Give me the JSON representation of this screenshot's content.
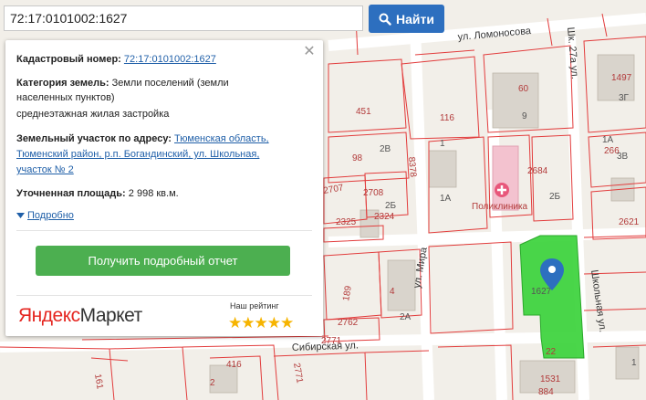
{
  "search": {
    "value": "72:17:0101002:1627",
    "button_label": "Найти"
  },
  "popup": {
    "cadastral_label": "Кадастровый номер:",
    "cadastral_value": "72:17:0101002:1627",
    "category_label": "Категория земель:",
    "category_value_line1": "Земли поселений (земли",
    "category_value_line2": "населенных пунктов)",
    "category_value_line3": "среднеэтажная жилая застройка",
    "address_label": "Земельный участок по адресу:",
    "address_line1": "Тюменская область,",
    "address_line2": "Тюменский район, р.п. Богандинский, ул. Школьная,",
    "address_line3": "участок № 2",
    "area_label": "Уточненная площадь:",
    "area_value": "2 998 кв.м.",
    "details_link": "Подробно",
    "report_button": "Получить подробный отчет",
    "brand_yandex": "Яндекс",
    "brand_market": "Маркет",
    "rating_label": "Наш рейтинг",
    "rating_stars": "★★★★★"
  },
  "map": {
    "streets": {
      "lomonosova": "ул. Ломоносова",
      "mira": "ул. Мира",
      "shkolnaya": "Школьная ул.",
      "sibirskaya": "Сибирская ул.",
      "shkolnaya_top": "Шк. 27а ул."
    },
    "poi": {
      "polyclinic": "Поликлиника"
    },
    "selected_parcel_label": "1627",
    "parcel_labels": [
      "451",
      "116",
      "60",
      "9",
      "1497",
      "3Г",
      "1А",
      "266",
      "3В",
      "2684",
      "2Б",
      "2В",
      "98",
      "1",
      "8378",
      "2707",
      "2708",
      "2Б",
      "2324",
      "2325",
      "1А",
      "2621",
      "189",
      "4",
      "2А",
      "2762",
      "2771",
      "416",
      "2771",
      "2",
      "161",
      "884",
      "1531",
      "22",
      "1"
    ],
    "colors": {
      "parcel_line": "#e23c3c",
      "selected_fill": "#3bd23b",
      "marker": "#2d6fbf",
      "building": "#d9d4cc"
    }
  }
}
